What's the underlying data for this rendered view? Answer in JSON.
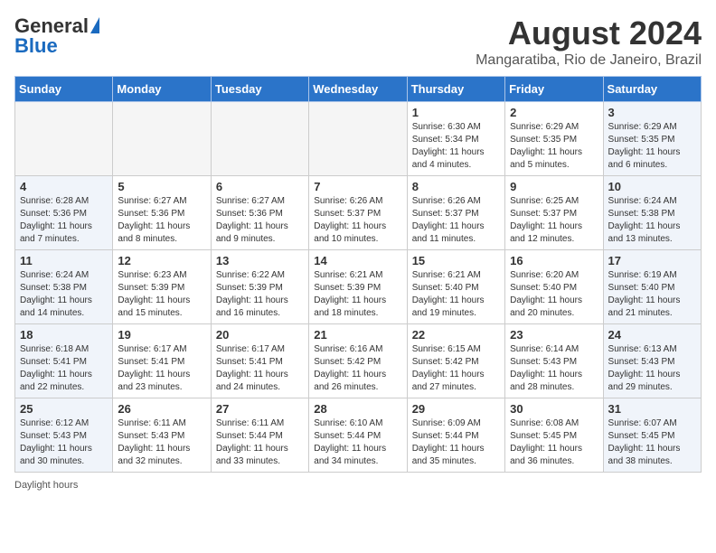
{
  "logo": {
    "general": "General",
    "blue": "Blue"
  },
  "title": "August 2024",
  "location": "Mangaratiba, Rio de Janeiro, Brazil",
  "weekdays": [
    "Sunday",
    "Monday",
    "Tuesday",
    "Wednesday",
    "Thursday",
    "Friday",
    "Saturday"
  ],
  "weeks": [
    [
      {
        "day": "",
        "empty": true
      },
      {
        "day": "",
        "empty": true
      },
      {
        "day": "",
        "empty": true
      },
      {
        "day": "",
        "empty": true
      },
      {
        "day": "1",
        "sunrise": "Sunrise: 6:30 AM",
        "sunset": "Sunset: 5:34 PM",
        "daylight": "Daylight: 11 hours and 4 minutes."
      },
      {
        "day": "2",
        "sunrise": "Sunrise: 6:29 AM",
        "sunset": "Sunset: 5:35 PM",
        "daylight": "Daylight: 11 hours and 5 minutes."
      },
      {
        "day": "3",
        "sunrise": "Sunrise: 6:29 AM",
        "sunset": "Sunset: 5:35 PM",
        "daylight": "Daylight: 11 hours and 6 minutes."
      }
    ],
    [
      {
        "day": "4",
        "sunrise": "Sunrise: 6:28 AM",
        "sunset": "Sunset: 5:36 PM",
        "daylight": "Daylight: 11 hours and 7 minutes."
      },
      {
        "day": "5",
        "sunrise": "Sunrise: 6:27 AM",
        "sunset": "Sunset: 5:36 PM",
        "daylight": "Daylight: 11 hours and 8 minutes."
      },
      {
        "day": "6",
        "sunrise": "Sunrise: 6:27 AM",
        "sunset": "Sunset: 5:36 PM",
        "daylight": "Daylight: 11 hours and 9 minutes."
      },
      {
        "day": "7",
        "sunrise": "Sunrise: 6:26 AM",
        "sunset": "Sunset: 5:37 PM",
        "daylight": "Daylight: 11 hours and 10 minutes."
      },
      {
        "day": "8",
        "sunrise": "Sunrise: 6:26 AM",
        "sunset": "Sunset: 5:37 PM",
        "daylight": "Daylight: 11 hours and 11 minutes."
      },
      {
        "day": "9",
        "sunrise": "Sunrise: 6:25 AM",
        "sunset": "Sunset: 5:37 PM",
        "daylight": "Daylight: 11 hours and 12 minutes."
      },
      {
        "day": "10",
        "sunrise": "Sunrise: 6:24 AM",
        "sunset": "Sunset: 5:38 PM",
        "daylight": "Daylight: 11 hours and 13 minutes."
      }
    ],
    [
      {
        "day": "11",
        "sunrise": "Sunrise: 6:24 AM",
        "sunset": "Sunset: 5:38 PM",
        "daylight": "Daylight: 11 hours and 14 minutes."
      },
      {
        "day": "12",
        "sunrise": "Sunrise: 6:23 AM",
        "sunset": "Sunset: 5:39 PM",
        "daylight": "Daylight: 11 hours and 15 minutes."
      },
      {
        "day": "13",
        "sunrise": "Sunrise: 6:22 AM",
        "sunset": "Sunset: 5:39 PM",
        "daylight": "Daylight: 11 hours and 16 minutes."
      },
      {
        "day": "14",
        "sunrise": "Sunrise: 6:21 AM",
        "sunset": "Sunset: 5:39 PM",
        "daylight": "Daylight: 11 hours and 18 minutes."
      },
      {
        "day": "15",
        "sunrise": "Sunrise: 6:21 AM",
        "sunset": "Sunset: 5:40 PM",
        "daylight": "Daylight: 11 hours and 19 minutes."
      },
      {
        "day": "16",
        "sunrise": "Sunrise: 6:20 AM",
        "sunset": "Sunset: 5:40 PM",
        "daylight": "Daylight: 11 hours and 20 minutes."
      },
      {
        "day": "17",
        "sunrise": "Sunrise: 6:19 AM",
        "sunset": "Sunset: 5:40 PM",
        "daylight": "Daylight: 11 hours and 21 minutes."
      }
    ],
    [
      {
        "day": "18",
        "sunrise": "Sunrise: 6:18 AM",
        "sunset": "Sunset: 5:41 PM",
        "daylight": "Daylight: 11 hours and 22 minutes."
      },
      {
        "day": "19",
        "sunrise": "Sunrise: 6:17 AM",
        "sunset": "Sunset: 5:41 PM",
        "daylight": "Daylight: 11 hours and 23 minutes."
      },
      {
        "day": "20",
        "sunrise": "Sunrise: 6:17 AM",
        "sunset": "Sunset: 5:41 PM",
        "daylight": "Daylight: 11 hours and 24 minutes."
      },
      {
        "day": "21",
        "sunrise": "Sunrise: 6:16 AM",
        "sunset": "Sunset: 5:42 PM",
        "daylight": "Daylight: 11 hours and 26 minutes."
      },
      {
        "day": "22",
        "sunrise": "Sunrise: 6:15 AM",
        "sunset": "Sunset: 5:42 PM",
        "daylight": "Daylight: 11 hours and 27 minutes."
      },
      {
        "day": "23",
        "sunrise": "Sunrise: 6:14 AM",
        "sunset": "Sunset: 5:43 PM",
        "daylight": "Daylight: 11 hours and 28 minutes."
      },
      {
        "day": "24",
        "sunrise": "Sunrise: 6:13 AM",
        "sunset": "Sunset: 5:43 PM",
        "daylight": "Daylight: 11 hours and 29 minutes."
      }
    ],
    [
      {
        "day": "25",
        "sunrise": "Sunrise: 6:12 AM",
        "sunset": "Sunset: 5:43 PM",
        "daylight": "Daylight: 11 hours and 30 minutes."
      },
      {
        "day": "26",
        "sunrise": "Sunrise: 6:11 AM",
        "sunset": "Sunset: 5:43 PM",
        "daylight": "Daylight: 11 hours and 32 minutes."
      },
      {
        "day": "27",
        "sunrise": "Sunrise: 6:11 AM",
        "sunset": "Sunset: 5:44 PM",
        "daylight": "Daylight: 11 hours and 33 minutes."
      },
      {
        "day": "28",
        "sunrise": "Sunrise: 6:10 AM",
        "sunset": "Sunset: 5:44 PM",
        "daylight": "Daylight: 11 hours and 34 minutes."
      },
      {
        "day": "29",
        "sunrise": "Sunrise: 6:09 AM",
        "sunset": "Sunset: 5:44 PM",
        "daylight": "Daylight: 11 hours and 35 minutes."
      },
      {
        "day": "30",
        "sunrise": "Sunrise: 6:08 AM",
        "sunset": "Sunset: 5:45 PM",
        "daylight": "Daylight: 11 hours and 36 minutes."
      },
      {
        "day": "31",
        "sunrise": "Sunrise: 6:07 AM",
        "sunset": "Sunset: 5:45 PM",
        "daylight": "Daylight: 11 hours and 38 minutes."
      }
    ]
  ],
  "footer": {
    "daylight_label": "Daylight hours"
  }
}
